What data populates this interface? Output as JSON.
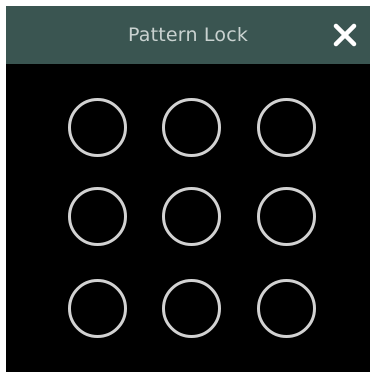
{
  "dialog": {
    "title": "Pattern Lock",
    "close_icon": "close-icon",
    "colors": {
      "titlebar": "#3a5551",
      "title_text": "#c9d2d0",
      "body": "#000000",
      "circle": "#d2d2d2"
    }
  },
  "pattern": {
    "rows": 3,
    "cols": 3,
    "selected": []
  }
}
